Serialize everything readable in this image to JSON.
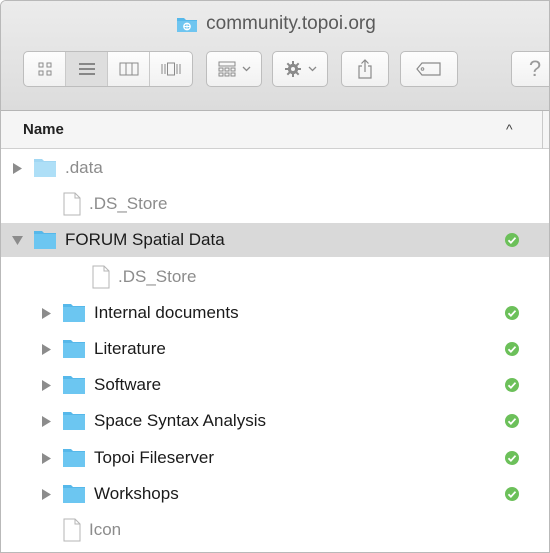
{
  "window": {
    "title": "community.topoi.org"
  },
  "toolbar": {
    "view_modes": [
      "icon-view",
      "list-view",
      "column-view",
      "cover-flow-view"
    ],
    "selected_view": "list-view",
    "help_label": "?"
  },
  "list_header": {
    "name_label": "Name",
    "sort_indicator": "^"
  },
  "colors": {
    "folder": "#56b8ea",
    "synced": "#6cc05a",
    "highlight": "#d9d9d9"
  },
  "rows": [
    {
      "label": ".data",
      "kind": "folder",
      "indent": 0,
      "expanded": false,
      "dim": true,
      "synced": false,
      "highlight": false
    },
    {
      "label": ".DS_Store",
      "kind": "file",
      "indent": 0,
      "expanded": false,
      "dim": true,
      "synced": false,
      "highlight": false
    },
    {
      "label": "FORUM Spatial Data",
      "kind": "folder",
      "indent": 0,
      "expanded": true,
      "dim": false,
      "synced": true,
      "highlight": true
    },
    {
      "label": ".DS_Store",
      "kind": "file",
      "indent": 1,
      "expanded": false,
      "dim": true,
      "synced": false,
      "highlight": false
    },
    {
      "label": "Internal documents",
      "kind": "folder",
      "indent": 1,
      "expanded": false,
      "dim": false,
      "synced": true,
      "highlight": false
    },
    {
      "label": "Literature",
      "kind": "folder",
      "indent": 1,
      "expanded": false,
      "dim": false,
      "synced": true,
      "highlight": false
    },
    {
      "label": "Software",
      "kind": "folder",
      "indent": 1,
      "expanded": false,
      "dim": false,
      "synced": true,
      "highlight": false
    },
    {
      "label": "Space Syntax Analysis",
      "kind": "folder",
      "indent": 1,
      "expanded": false,
      "dim": false,
      "synced": true,
      "highlight": false
    },
    {
      "label": "Topoi Fileserver",
      "kind": "folder",
      "indent": 1,
      "expanded": false,
      "dim": false,
      "synced": true,
      "highlight": false
    },
    {
      "label": "Workshops",
      "kind": "folder",
      "indent": 1,
      "expanded": false,
      "dim": false,
      "synced": true,
      "highlight": false
    },
    {
      "label": "Icon",
      "kind": "file",
      "indent": 0,
      "expanded": false,
      "dim": true,
      "synced": false,
      "highlight": false
    }
  ]
}
